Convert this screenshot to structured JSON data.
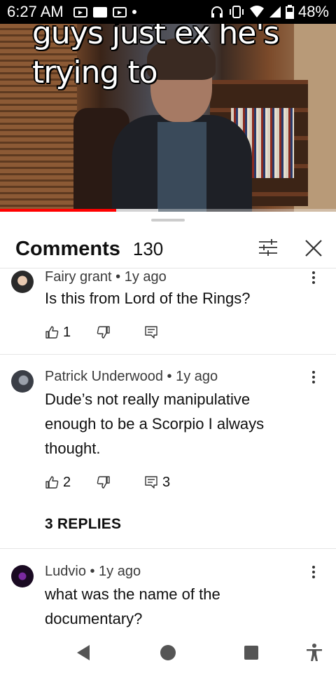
{
  "status_bar": {
    "time": "6:27 AM",
    "battery": "48%",
    "icons": [
      "youtube-icon",
      "gallery-icon",
      "youtube-icon",
      "dot-icon",
      "headphones-icon",
      "vibrate-icon",
      "wifi-icon",
      "signal-icon",
      "battery-icon"
    ]
  },
  "video": {
    "caption": "guys just ex he's trying to",
    "progress_played": 0.345,
    "progress_buffered_end": 0.47
  },
  "comments_panel": {
    "title": "Comments",
    "count": "130",
    "filter_icon": "filter-sliders-icon",
    "close_icon": "close-icon"
  },
  "comments": [
    {
      "author": "Fairy grant",
      "time": "1y ago",
      "meta": "Fairy grant • 1y ago",
      "text": "Is this from Lord of the Rings?",
      "likes": "1",
      "replies_count": ""
    },
    {
      "author": "Patrick Underwood",
      "time": "1y ago",
      "meta": "Patrick Underwood • 1y ago",
      "text": "Dude’s not really manipulative enough to be a Scorpio I always thought.",
      "likes": "2",
      "replies_count": "3",
      "replies_link": "3 REPLIES"
    },
    {
      "author": "Ludvio",
      "time": "1y ago",
      "meta": "Ludvio • 1y ago",
      "text": "what was the name of the documentary?",
      "likes": "",
      "replies_count": ""
    }
  ],
  "nav_bar": {
    "icons": [
      "back-triangle-icon",
      "home-circle-icon",
      "recents-square-icon",
      "accessibility-icon"
    ]
  }
}
